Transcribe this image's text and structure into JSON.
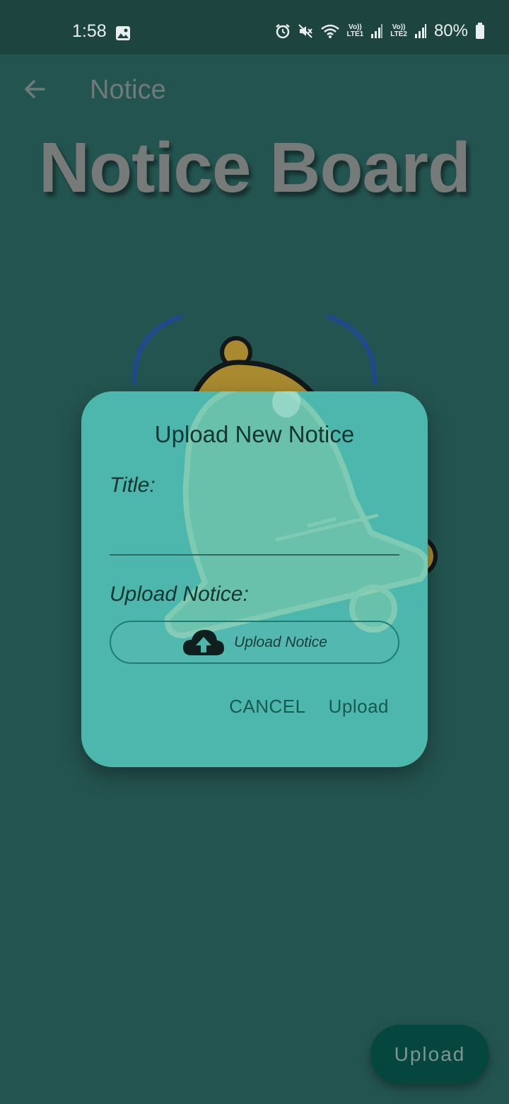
{
  "status_bar": {
    "time": "1:58",
    "sim1_label": "Vo))\nLTE1",
    "sim2_label": "Vo))\nLTE2",
    "battery": "80%"
  },
  "app_bar": {
    "title": "Notice"
  },
  "board": {
    "title": "Notice Board"
  },
  "dialog": {
    "title": "Upload New Notice",
    "title_label": "Title:",
    "title_value": "",
    "upload_label": "Upload Notice:",
    "upload_button": "Upload Notice",
    "cancel": "CANCEL",
    "upload": "Upload"
  },
  "fab": {
    "label": "Upload"
  },
  "colors": {
    "background": "#245450",
    "dialog": "#4db7ad",
    "fab": "#05463f",
    "bell": "#a98a30"
  }
}
